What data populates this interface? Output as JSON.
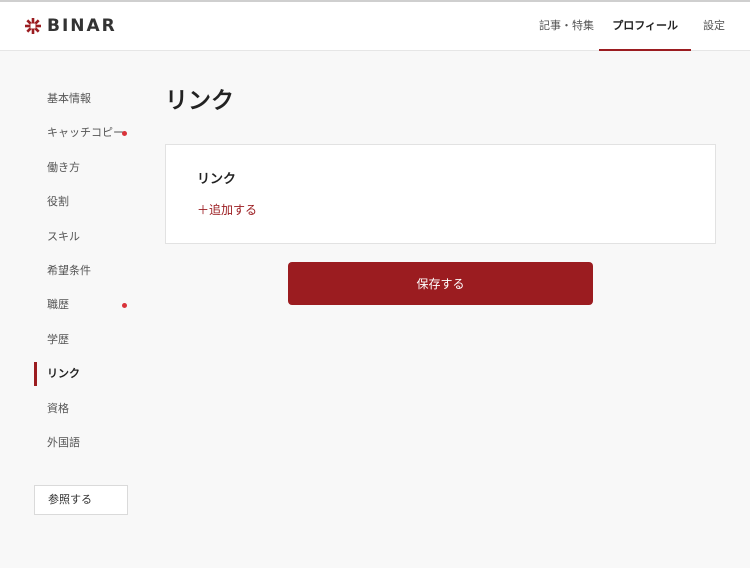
{
  "brand": {
    "name": "BINAR",
    "accent": "#9b1c20",
    "dot_color": "#d9333a"
  },
  "nav": {
    "items": [
      {
        "label": "記事・特集",
        "active": false
      },
      {
        "label": "プロフィール",
        "active": true
      },
      {
        "label": "設定",
        "active": false
      }
    ]
  },
  "sidebar": {
    "items": [
      {
        "label": "基本情報",
        "active": false,
        "alert": false
      },
      {
        "label": "キャッチコピー",
        "active": false,
        "alert": true
      },
      {
        "label": "働き方",
        "active": false,
        "alert": false
      },
      {
        "label": "役割",
        "active": false,
        "alert": false
      },
      {
        "label": "スキル",
        "active": false,
        "alert": false
      },
      {
        "label": "希望条件",
        "active": false,
        "alert": false
      },
      {
        "label": "職歴",
        "active": false,
        "alert": true
      },
      {
        "label": "学歴",
        "active": false,
        "alert": false
      },
      {
        "label": "リンク",
        "active": true,
        "alert": false
      },
      {
        "label": "資格",
        "active": false,
        "alert": false
      },
      {
        "label": "外国語",
        "active": false,
        "alert": false
      }
    ],
    "reference_button": "参照する"
  },
  "main": {
    "title": "リンク",
    "card": {
      "title": "リンク",
      "add_label": "＋追加する"
    },
    "save_button": "保存する"
  }
}
